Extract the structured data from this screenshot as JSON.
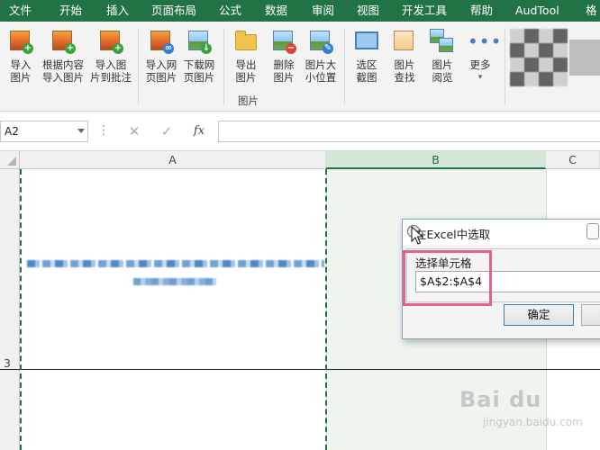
{
  "tabs": [
    "文件",
    "开始",
    "插入",
    "页面布局",
    "公式",
    "数据",
    "审阅",
    "视图",
    "开发工具",
    "帮助",
    "AudTool",
    "格"
  ],
  "ribbon": {
    "buttons": [
      {
        "line1": "导入",
        "line2": "图片",
        "icon": "image-add-icon"
      },
      {
        "line1": "根据内容",
        "line2": "导入图片",
        "icon": "image-add-icon"
      },
      {
        "line1": "导入图",
        "line2": "片到批注",
        "icon": "image-comment-icon"
      },
      {
        "line1": "导入网",
        "line2": "页图片",
        "icon": "image-link-icon"
      },
      {
        "line1": "下载网",
        "line2": "页图片",
        "icon": "image-download-icon"
      },
      {
        "line1": "导出",
        "line2": "图片",
        "icon": "folder-icon"
      },
      {
        "line1": "删除",
        "line2": "图片",
        "icon": "image-delete-icon"
      },
      {
        "line1": "图片大",
        "line2": "小位置",
        "icon": "image-resize-icon"
      },
      {
        "line1": "选区",
        "line2": "截图",
        "icon": "screenshot-icon"
      },
      {
        "line1": "图片",
        "line2": "查找",
        "icon": "image-search-icon"
      },
      {
        "line1": "图片",
        "line2": "阅览",
        "icon": "image-gallery-icon"
      },
      {
        "line1": "更多",
        "line2": "",
        "icon": "more-icon"
      }
    ],
    "group_label": "图片"
  },
  "formula_bar": {
    "name_box": "A2",
    "cancel_glyph": "✕",
    "enter_glyph": "✓",
    "fx_glyph": "fx",
    "formula": ""
  },
  "grid": {
    "columns": [
      "A",
      "B",
      "C"
    ],
    "rows": [
      "3"
    ],
    "selected_column": "B"
  },
  "dialog": {
    "title": "在Excel中选取",
    "prompt": "选择单元格",
    "value": "$A$2:$A$4",
    "ok_label": "确定"
  },
  "watermark": {
    "logo": "Bai du",
    "sub": "jingyan.baidu.com"
  },
  "colors": {
    "accent": "#217346",
    "highlight": "#e8608a"
  }
}
